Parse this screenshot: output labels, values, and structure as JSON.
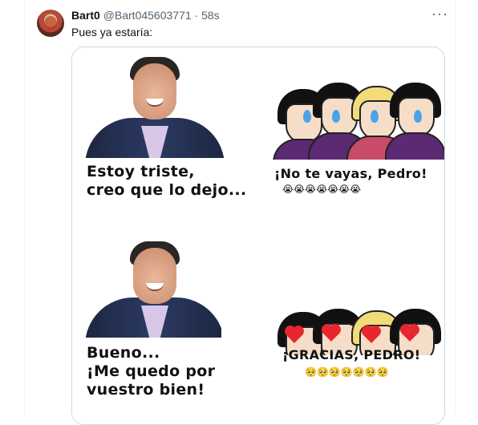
{
  "tweet": {
    "author_name": "Bart0",
    "handle": "@Bart045603771",
    "separator": "·",
    "time": "58s",
    "more_label": "···",
    "text": "Pues ya estaría:"
  },
  "meme": {
    "panel1": {
      "line1": "Estoy triste,",
      "line2": "creo que lo dejo..."
    },
    "panel2": {
      "caption": "¡No te vayas, Pedro!",
      "emojis": "😭😭😭😭😭😭😭"
    },
    "panel3": {
      "line1": "Bueno...",
      "line2": "¡Me quedo por",
      "line3": "vuestro bien!"
    },
    "panel4": {
      "caption": "¡GRACIAS, PEDRO!",
      "emojis": "🥺🥺🥺🥺🥺🥺🥺"
    }
  },
  "colors": {
    "text_primary": "#0f1419",
    "text_secondary": "#536471",
    "border": "#cfd9de"
  }
}
